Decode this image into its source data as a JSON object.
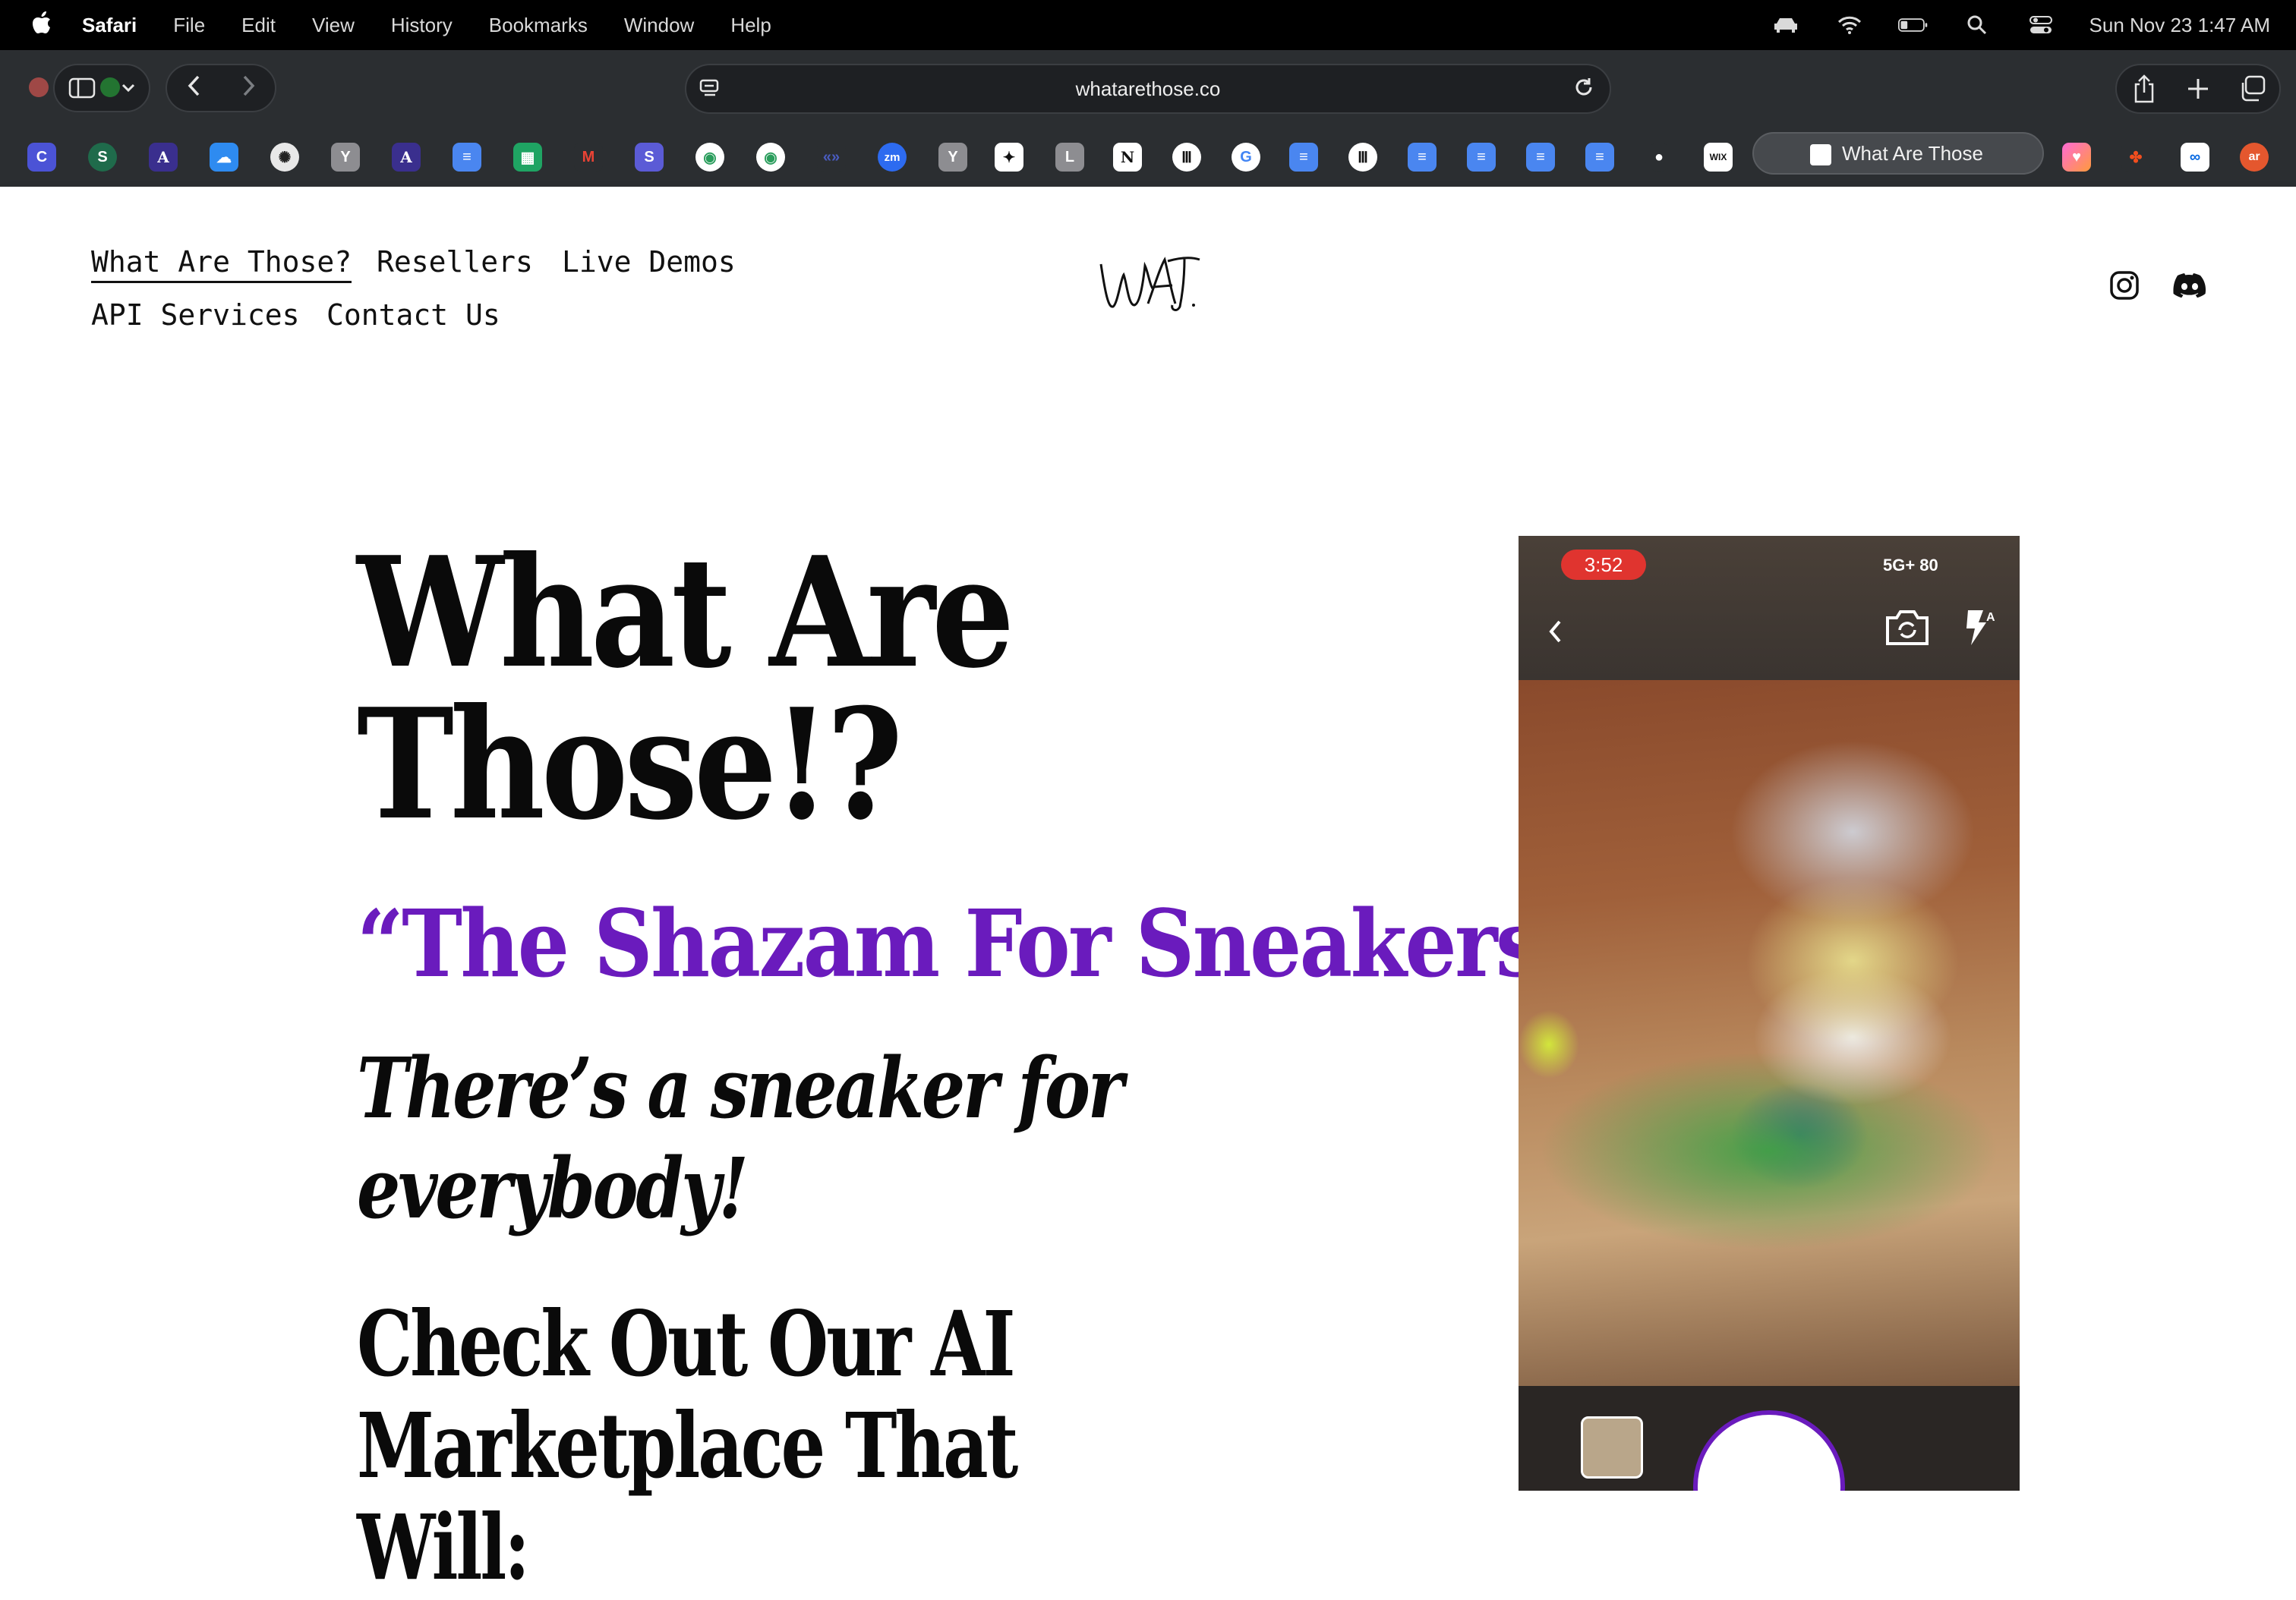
{
  "menubar": {
    "app_name": "Safari",
    "menus": [
      "File",
      "Edit",
      "View",
      "History",
      "Bookmarks",
      "Window",
      "Help"
    ],
    "clock": "Sun Nov 23  1:47 AM"
  },
  "browser": {
    "url": "whatarethose.co",
    "active_tab": "What Are Those"
  },
  "site": {
    "nav": {
      "what_are_those": "What Are Those?",
      "resellers": "Resellers",
      "live_demos": "Live Demos",
      "api_services": "API Services",
      "contact_us": "Contact Us"
    },
    "hero": {
      "title_line1": "What Are",
      "title_line2": "Those!?",
      "tagline": "“The Shazam For Sneakers”",
      "subtagline_line1": "There’s a sneaker for",
      "subtagline_line2": "everybody!",
      "cta_line1": "Check Out Our AI",
      "cta_line2": "Marketplace That Will:"
    },
    "phone": {
      "time": "3:52",
      "signal": "5G+ 80"
    }
  },
  "colors": {
    "accent_purple": "#6a1bbd",
    "menubar_bg": "#000000",
    "chrome_bg": "#2b2e31"
  }
}
